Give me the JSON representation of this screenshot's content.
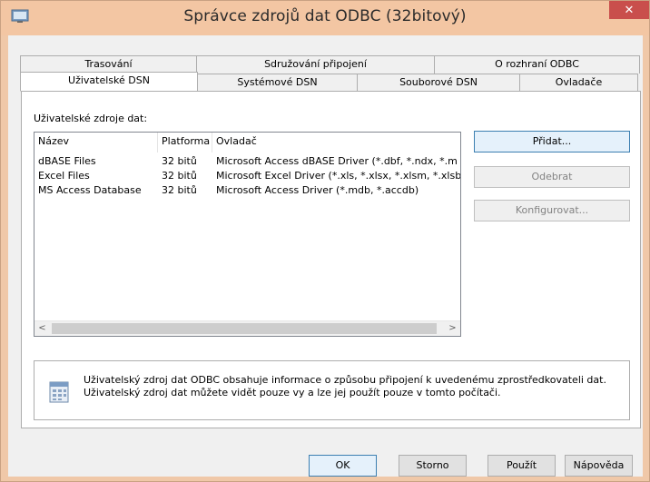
{
  "window": {
    "title": "Správce zdrojů dat ODBC (32bitový)",
    "close_label": "✕",
    "icons": {
      "app": "odbc-app-icon",
      "close": "close-icon"
    },
    "colors": {
      "titlebar": "#f3c6a3",
      "close": "#c94f4c"
    }
  },
  "tabs": {
    "row1": [
      {
        "label": "Trasování"
      },
      {
        "label": "Sdružování připojení"
      },
      {
        "label": "O rozhraní ODBC"
      }
    ],
    "row2": [
      {
        "label": "Uživatelské DSN",
        "active": true
      },
      {
        "label": "Systémové DSN"
      },
      {
        "label": "Souborové DSN"
      },
      {
        "label": "Ovladače"
      }
    ]
  },
  "panel": {
    "section_label": "Uživatelské zdroje dat:",
    "columns": [
      "Název",
      "Platforma",
      "Ovladač"
    ],
    "rows": [
      {
        "name": "dBASE Files",
        "platform": "32 bitů",
        "driver": "Microsoft Access dBASE Driver (*.dbf, *.ndx, *.m"
      },
      {
        "name": "Excel Files",
        "platform": "32 bitů",
        "driver": "Microsoft Excel Driver (*.xls, *.xlsx, *.xlsm, *.xlsb"
      },
      {
        "name": "MS Access Database",
        "platform": "32 bitů",
        "driver": "Microsoft Access Driver (*.mdb, *.accdb)"
      }
    ],
    "scroll_left": "<",
    "scroll_right": ">",
    "buttons": {
      "add": "Přidat...",
      "remove": "Odebrat",
      "configure": "Konfigurovat..."
    },
    "info_text": "Uživatelský zdroj dat ODBC obsahuje informace o způsobu připojení k uvedenému zprostředkovateli dat. Uživatelský zdroj dat můžete vidět pouze vy a lze jej použít pouze v tomto počítači."
  },
  "footer": {
    "ok": "OK",
    "cancel": "Storno",
    "apply": "Použít",
    "help": "Nápověda"
  }
}
